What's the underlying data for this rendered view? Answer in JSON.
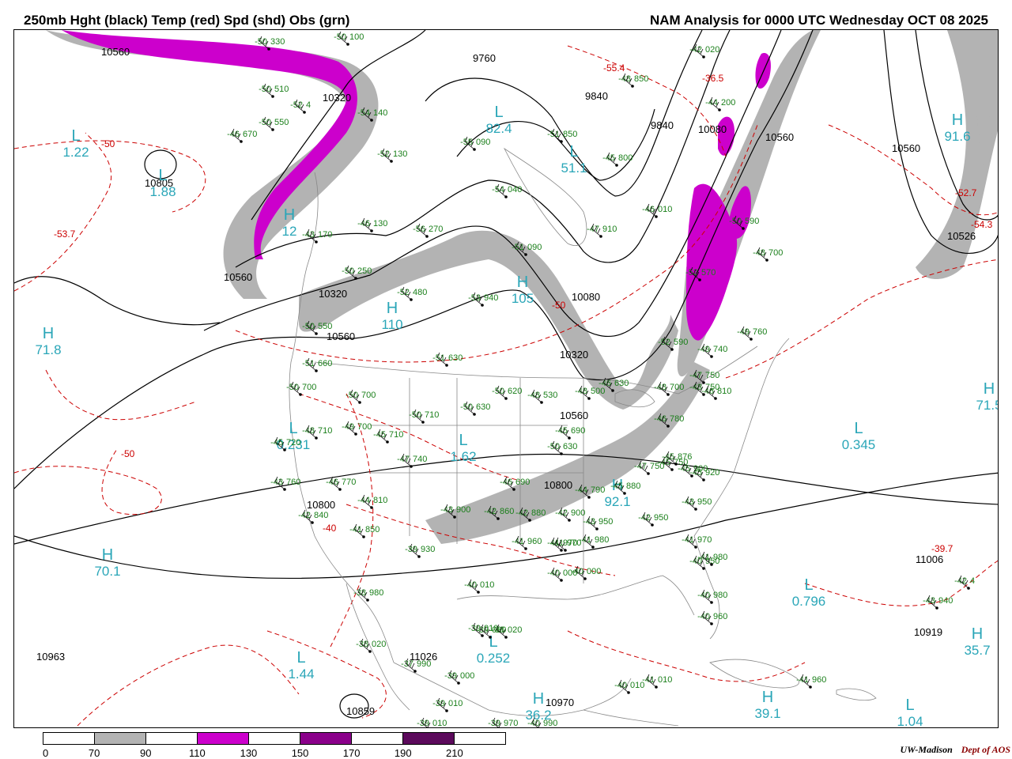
{
  "header": {
    "left_title": "250mb Hght (black) Temp (red) Spd (shd) Obs (grn)",
    "right_title": "NAM Analysis for 0000 UTC Wednesday  OCT 08 2025"
  },
  "colors": {
    "height_contour": "#000000",
    "temp_contour": "#cc0000",
    "obs_text": "#1a7f1a",
    "speed_label": "#2aa6b8",
    "shade_70_90": "#b3b3b3",
    "shade_110_130": "#cc00cc",
    "shade_130_150": "#ffffff",
    "shade_150_170": "#8b008b",
    "shade_190_210": "#5c0a5c",
    "border_lines": "#888888"
  },
  "legend": {
    "ticks": [
      "0",
      "70",
      "90",
      "110",
      "130",
      "150",
      "170",
      "190",
      "210"
    ],
    "segments": [
      "#ffffff",
      "#b3b3b3",
      "#ffffff",
      "#cc00cc",
      "#ffffff",
      "#8b008b",
      "#ffffff",
      "#5c0a5c",
      "#ffffff"
    ]
  },
  "credit": {
    "institution": "UW-Madison",
    "department": "Dept of AOS"
  },
  "height_labels": [
    {
      "text": "10560",
      "hx": "10560"
    },
    {
      "text": "10805"
    },
    {
      "text": "10320"
    },
    {
      "text": "9840"
    },
    {
      "text": "9840"
    },
    {
      "text": "10080"
    },
    {
      "text": "10560"
    },
    {
      "text": "10560"
    },
    {
      "text": "10526"
    },
    {
      "text": "10560"
    },
    {
      "text": "10320"
    },
    {
      "text": "10080"
    },
    {
      "text": "10320"
    },
    {
      "text": "10560"
    },
    {
      "text": "10560"
    },
    {
      "text": "10800"
    },
    {
      "text": "10800"
    },
    {
      "text": "11006"
    },
    {
      "text": "10919"
    },
    {
      "text": "10963"
    },
    {
      "text": "11026"
    },
    {
      "text": "10970"
    },
    {
      "text": "10859"
    },
    {
      "text": "9760"
    }
  ],
  "temp_labels": [
    "-53.7",
    "-50",
    "-55.4",
    "-36.5",
    "-52.7",
    "-54.3",
    "-50",
    "-39.7",
    "-40",
    "-50"
  ],
  "hl_markers": [
    {
      "kind": "L",
      "val": "1.22",
      "type": "spd"
    },
    {
      "kind": "L",
      "val": "1.88",
      "type": "spd"
    },
    {
      "kind": "H",
      "val": "71.8",
      "type": "spd"
    },
    {
      "kind": "L",
      "val": "0.231",
      "type": "spd"
    },
    {
      "kind": "L",
      "val": "1.62",
      "type": "spd"
    },
    {
      "kind": "H",
      "val": "70.1",
      "type": "spd"
    },
    {
      "kind": "L",
      "val": "1.44",
      "type": "spd"
    },
    {
      "kind": "L",
      "val": "0.252",
      "type": "spd"
    },
    {
      "kind": "H",
      "val": "36.2",
      "type": "spd"
    },
    {
      "kind": "H",
      "val": "39.1",
      "type": "spd"
    },
    {
      "kind": "L",
      "val": "1.04",
      "type": "spd"
    },
    {
      "kind": "H",
      "val": "35.7",
      "type": "spd"
    },
    {
      "kind": "L",
      "val": "0.796",
      "type": "spd"
    },
    {
      "kind": "L",
      "val": "0.345",
      "type": "spd"
    },
    {
      "kind": "H",
      "val": "71.5",
      "type": "spd"
    },
    {
      "kind": "H",
      "val": "91.6",
      "type": "spd"
    },
    {
      "kind": "H",
      "val": "105",
      "type": "spd"
    },
    {
      "kind": "H",
      "val": "92.1",
      "type": "spd"
    },
    {
      "kind": "H",
      "val": "110",
      "type": "spd"
    },
    {
      "kind": "L",
      "val": "82.4",
      "type": "spd"
    },
    {
      "kind": "L",
      "val": "51.1",
      "type": "spd"
    },
    {
      "kind": "H",
      "val": "12",
      "type": "spd"
    }
  ],
  "obs": [
    {
      "t": "-50",
      "h": "330"
    },
    {
      "t": "-50",
      "h": "100"
    },
    {
      "t": "-50",
      "h": "510"
    },
    {
      "t": "-52",
      "h": "4"
    },
    {
      "t": "-50",
      "h": "550"
    },
    {
      "t": "-46",
      "h": "670"
    },
    {
      "t": "-54",
      "h": "140"
    },
    {
      "t": "-52",
      "h": "130"
    },
    {
      "t": "-46",
      "h": "130"
    },
    {
      "t": "-56",
      "h": "270"
    },
    {
      "t": "-51",
      "h": "090"
    },
    {
      "t": "-54",
      "h": "040"
    },
    {
      "t": "-55",
      "h": "090"
    },
    {
      "t": "-51",
      "h": "850"
    },
    {
      "t": "-45",
      "h": "800"
    },
    {
      "t": "-46",
      "h": "010"
    },
    {
      "t": "-47",
      "h": "910"
    },
    {
      "t": "-48",
      "h": "850"
    },
    {
      "t": "-42",
      "h": "020"
    },
    {
      "t": "-44",
      "h": "200"
    },
    {
      "t": "-43",
      "h": "170"
    },
    {
      "t": "-50",
      "h": "250"
    },
    {
      "t": "-52",
      "h": "480"
    },
    {
      "t": "-53",
      "h": "940"
    },
    {
      "t": "-50",
      "h": "550"
    },
    {
      "t": "-51",
      "h": "660"
    },
    {
      "t": "-51",
      "h": "630"
    },
    {
      "t": "-50",
      "h": "700"
    },
    {
      "t": "-50",
      "h": "700"
    },
    {
      "t": "-50",
      "h": "710"
    },
    {
      "t": "-48",
      "h": "710"
    },
    {
      "t": "-49",
      "h": "700"
    },
    {
      "t": "-45",
      "h": "720"
    },
    {
      "t": "-45",
      "h": "710"
    },
    {
      "t": "-47",
      "h": "740"
    },
    {
      "t": "-50",
      "h": "630"
    },
    {
      "t": "-50",
      "h": "620"
    },
    {
      "t": "-48",
      "h": "530"
    },
    {
      "t": "-48",
      "h": "500"
    },
    {
      "t": "-46",
      "h": "630"
    },
    {
      "t": "-45",
      "h": "690"
    },
    {
      "t": "-50",
      "h": "630"
    },
    {
      "t": "-46",
      "h": "780"
    },
    {
      "t": "-47",
      "h": "750"
    },
    {
      "t": "-48",
      "h": "700"
    },
    {
      "t": "-48",
      "h": "750"
    },
    {
      "t": "-46",
      "h": "810"
    },
    {
      "t": "-49",
      "h": "740"
    },
    {
      "t": "-49",
      "h": "760"
    },
    {
      "t": "-52",
      "h": "590"
    },
    {
      "t": "-52",
      "h": "570"
    },
    {
      "t": "-50",
      "h": "590"
    },
    {
      "t": "-48",
      "h": "700"
    },
    {
      "t": "-45",
      "h": "750"
    },
    {
      "t": "-44",
      "h": "790"
    },
    {
      "t": "-46",
      "h": "690"
    },
    {
      "t": "-43",
      "h": "760"
    },
    {
      "t": "-46",
      "h": "770"
    },
    {
      "t": "-44",
      "h": "810"
    },
    {
      "t": "-42",
      "h": "840"
    },
    {
      "t": "-41",
      "h": "850"
    },
    {
      "t": "-43",
      "h": "900"
    },
    {
      "t": "-42",
      "h": "860"
    },
    {
      "t": "-42",
      "h": "880"
    },
    {
      "t": "-42",
      "h": "900"
    },
    {
      "t": "-45",
      "h": "880"
    },
    {
      "t": "-47",
      "h": "750"
    },
    {
      "t": "-45",
      "h": "876"
    },
    {
      "t": "-45",
      "h": "900"
    },
    {
      "t": "-45",
      "h": "920"
    },
    {
      "t": "-43",
      "h": "950"
    },
    {
      "t": "-43",
      "h": "950"
    },
    {
      "t": "-42",
      "h": "950"
    },
    {
      "t": "-41",
      "h": "960"
    },
    {
      "t": "-41",
      "h": "970"
    },
    {
      "t": "-41",
      "h": "980"
    },
    {
      "t": "-41",
      "h": "970"
    },
    {
      "t": "-40",
      "h": "950"
    },
    {
      "t": "-39",
      "h": "930"
    },
    {
      "t": "-40",
      "h": "010"
    },
    {
      "t": "-40",
      "h": "000"
    },
    {
      "t": "-40",
      "h": "000"
    },
    {
      "t": "-41",
      "h": "970"
    },
    {
      "t": "-41",
      "h": "980"
    },
    {
      "t": "-40",
      "h": "980"
    },
    {
      "t": "-40",
      "h": "960"
    },
    {
      "t": "-38",
      "h": "980"
    },
    {
      "t": "-39",
      "h": "010"
    },
    {
      "t": "-39",
      "h": "030"
    },
    {
      "t": "-38",
      "h": "020"
    },
    {
      "t": "-38",
      "h": "020"
    },
    {
      "t": "-37",
      "h": "990"
    },
    {
      "t": "-39",
      "h": "000"
    },
    {
      "t": "-39",
      "h": "010"
    },
    {
      "t": "-39",
      "h": "010"
    },
    {
      "t": "-39",
      "h": "970"
    },
    {
      "t": "-40",
      "h": "990"
    },
    {
      "t": "-40",
      "h": "010"
    },
    {
      "t": "-41",
      "h": "010"
    },
    {
      "t": "-41",
      "h": "960"
    },
    {
      "t": "-43",
      "h": "940"
    },
    {
      "t": "-42",
      "h": "4"
    }
  ]
}
